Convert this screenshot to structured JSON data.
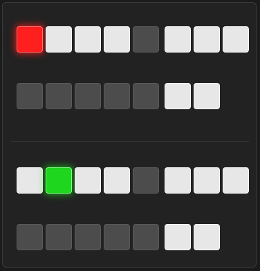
{
  "groups": [
    {
      "label": "",
      "rows": [
        {
          "buttons": [
            {
              "label": "",
              "state": "red"
            },
            {
              "label": "",
              "state": "lit"
            },
            {
              "label": "",
              "state": "lit"
            },
            {
              "label": "",
              "state": "lit"
            },
            {
              "label": "",
              "state": "dark"
            },
            {
              "label": "",
              "state": "lit"
            },
            {
              "label": "",
              "state": "lit"
            },
            {
              "label": "",
              "state": "lit"
            }
          ]
        },
        {
          "buttons": [
            {
              "label": "",
              "state": "dark"
            },
            {
              "label": "",
              "state": "dark"
            },
            {
              "label": "",
              "state": "dark"
            },
            {
              "label": "",
              "state": "dark"
            },
            {
              "label": "",
              "state": "dark"
            },
            {
              "label": "",
              "state": "lit"
            },
            {
              "label": "",
              "state": "lit"
            }
          ]
        }
      ]
    },
    {
      "label": "",
      "rows": [
        {
          "buttons": [
            {
              "label": "",
              "state": "lit"
            },
            {
              "label": "",
              "state": "green"
            },
            {
              "label": "",
              "state": "lit"
            },
            {
              "label": "",
              "state": "lit"
            },
            {
              "label": "",
              "state": "dark"
            },
            {
              "label": "",
              "state": "lit"
            },
            {
              "label": "",
              "state": "lit"
            },
            {
              "label": "",
              "state": "lit"
            }
          ]
        },
        {
          "buttons": [
            {
              "label": "",
              "state": "dark"
            },
            {
              "label": "",
              "state": "dark"
            },
            {
              "label": "",
              "state": "dark"
            },
            {
              "label": "",
              "state": "dark"
            },
            {
              "label": "",
              "state": "dark"
            },
            {
              "label": "",
              "state": "lit"
            },
            {
              "label": "",
              "state": "lit"
            }
          ]
        }
      ]
    }
  ],
  "colors": {
    "background": "#1b1b1b",
    "button_lit": "#e7e7e7",
    "button_unlit": "#4c4c4c",
    "active_red": "#ff1f1f",
    "active_green": "#1ed61e"
  }
}
